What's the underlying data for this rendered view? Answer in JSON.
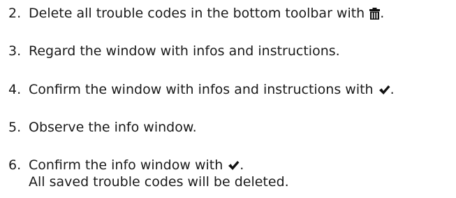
{
  "steps": [
    {
      "number": "2.",
      "text": "Delete all trouble codes in the bottom toolbar with",
      "icon": "trash-icon",
      "suffix": "."
    },
    {
      "number": "3.",
      "text": "Regard the window with infos and instructions."
    },
    {
      "number": "4.",
      "text": "Confirm the window with infos and instructions with",
      "icon": "checkmark-icon",
      "suffix": "."
    },
    {
      "number": "5.",
      "text": "Observe the info window."
    },
    {
      "number": "6.",
      "text": "Confirm the info window with",
      "icon": "checkmark-icon",
      "suffix": ".",
      "subtext": "All saved trouble codes will be deleted."
    }
  ]
}
